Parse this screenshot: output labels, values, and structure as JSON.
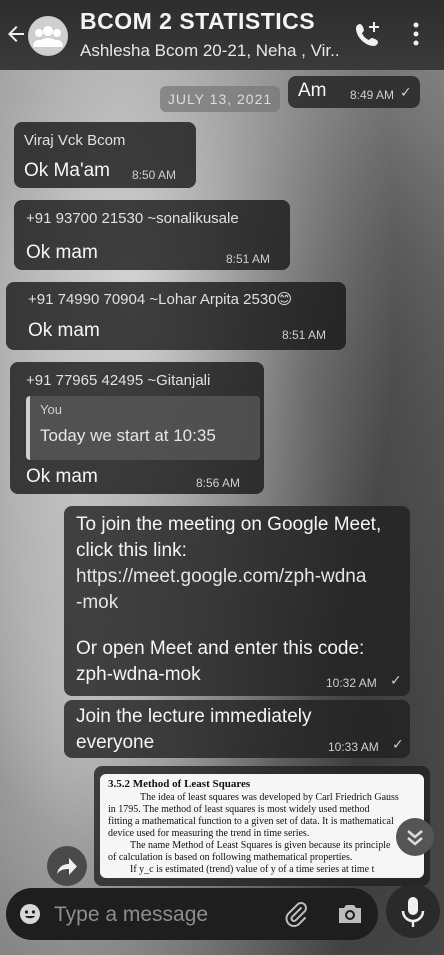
{
  "header": {
    "title": "BCOM 2 STATISTICS",
    "subtitle": "Ashlesha Bcom 20-21, Neha , Vir..."
  },
  "date_chip": "JULY 13, 2021",
  "messages": [
    {
      "id": "top-out",
      "text": "Am",
      "time": "8:49 AM"
    },
    {
      "id": "viraj",
      "sender": "Viraj Vck Bcom",
      "text": "Ok Ma'am",
      "time": "8:50 AM"
    },
    {
      "id": "sonali",
      "sender": "+91 93700 21530 ~sonalikusale",
      "text": "Ok mam",
      "time": "8:51 AM"
    },
    {
      "id": "arpita",
      "sender": "+91 74990 70904 ~Lohar Arpita 2530😊",
      "text": "Ok mam",
      "time": "8:51 AM"
    },
    {
      "id": "gitanjali",
      "sender": "+91 77965 42495 ~Gitanjali",
      "quote_author": "You",
      "quote_text": "Today we start at 10:35",
      "text": "Ok mam",
      "time": "8:56 AM"
    },
    {
      "id": "meet",
      "line1": "To join the meeting on Google Meet,",
      "line2": "click this link:",
      "link1": "https://meet.google.com/zph-wdna",
      "link2": "-mok",
      "line3": "Or open Meet and enter this code:",
      "code": "zph-wdna-mok",
      "time": "10:32 AM"
    },
    {
      "id": "lecture",
      "line1": "Join the lecture immediately",
      "line2": "everyone",
      "time": "10:33 AM"
    }
  ],
  "document": {
    "heading": "3.5.2  Method of Least Squares",
    "lines": [
      "The idea of least squares was developed by Carl Friedrich Gauss",
      "in 1795. The method of least squares is most widely used method",
      "fitting a mathematical function to a given set of data. It is mathematical",
      "device used for measuring the trend in time series.",
      "The name Method of Least Squares is given because its principle",
      "of calculation is based on following mathematical properties.",
      "If y_c is estimated (trend) value of y of a time series at time t"
    ]
  },
  "composer": {
    "placeholder": "Type a message"
  },
  "icons": {
    "back": "back-arrow-icon",
    "avatar": "group-avatar-icon",
    "call": "add-call-icon",
    "menu": "more-vert-icon",
    "share": "forward-icon",
    "scroll": "scroll-down-icon",
    "emoji": "emoji-icon",
    "attach": "paperclip-icon",
    "camera": "camera-icon",
    "mic": "mic-icon"
  }
}
